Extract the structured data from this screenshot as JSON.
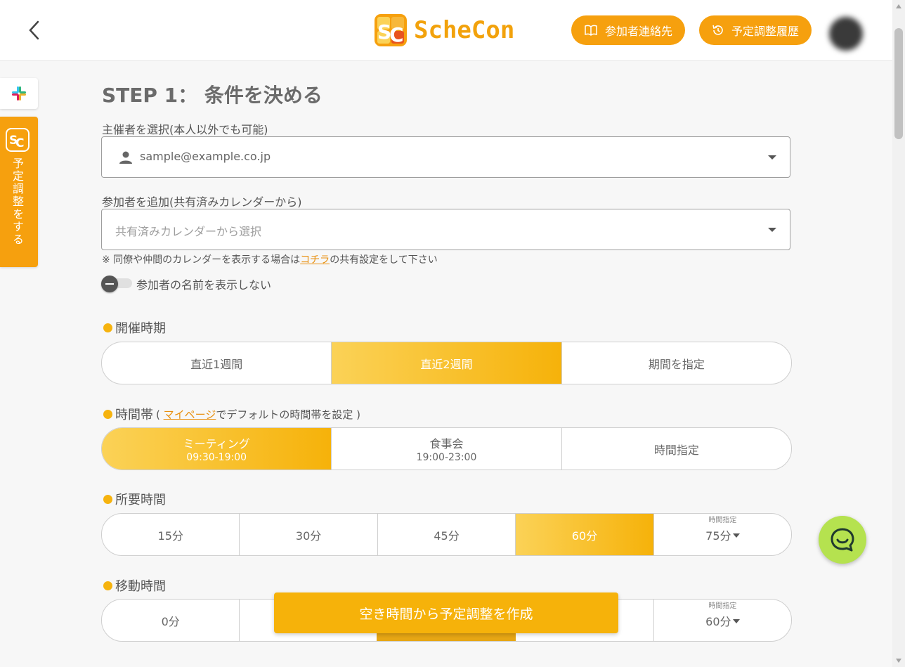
{
  "header": {
    "logo_text": "ScheCon",
    "contacts_button": "参加者連絡先",
    "history_button": "予定調整履歴"
  },
  "side": {
    "schedule_tab": "予定調整をする"
  },
  "main": {
    "step_title": "STEP 1： 条件を決める",
    "organizer_label": "主催者を選択(本人以外でも可能)",
    "organizer_value": "sample@example.co.jp",
    "participants_label": "参加者を追加(共有済みカレンダーから)",
    "participants_placeholder": "共有済みカレンダーから選択",
    "note_prefix": "※ 同僚や仲間のカレンダーを表示する場合は",
    "note_link": "コチラ",
    "note_suffix": "の共有設定をして下さい",
    "hide_names_label": "参加者の名前を表示しない",
    "hide_names_on": false
  },
  "period": {
    "label": "開催時期",
    "options": [
      "直近1週間",
      "直近2週間",
      "期間を指定"
    ],
    "selected": "直近2週間"
  },
  "timeslot": {
    "label": "時間帯",
    "sub_open": "( ",
    "sub_link": "マイページ",
    "sub_text": "でデフォルトの時間帯を設定 )",
    "options": [
      {
        "name": "ミーティング",
        "time": "09:30-19:00"
      },
      {
        "name": "食事会",
        "time": "19:00-23:00"
      },
      {
        "name": "時間指定",
        "time": ""
      }
    ],
    "selected": "ミーティング"
  },
  "duration": {
    "label": "所要時間",
    "options": [
      "15分",
      "30分",
      "45分",
      "60分"
    ],
    "selected": "60分",
    "custom_label": "時間指定",
    "custom_value": "75分"
  },
  "travel": {
    "label": "移動時間",
    "first_option": "0分",
    "custom_label": "時間指定",
    "custom_value": "60分"
  },
  "create_button": "空き時間から予定調整を作成",
  "colors": {
    "accent": "#f6a00e",
    "active_start": "#fbd257",
    "active_end": "#f6b20a",
    "chat": "#b5e24f"
  }
}
